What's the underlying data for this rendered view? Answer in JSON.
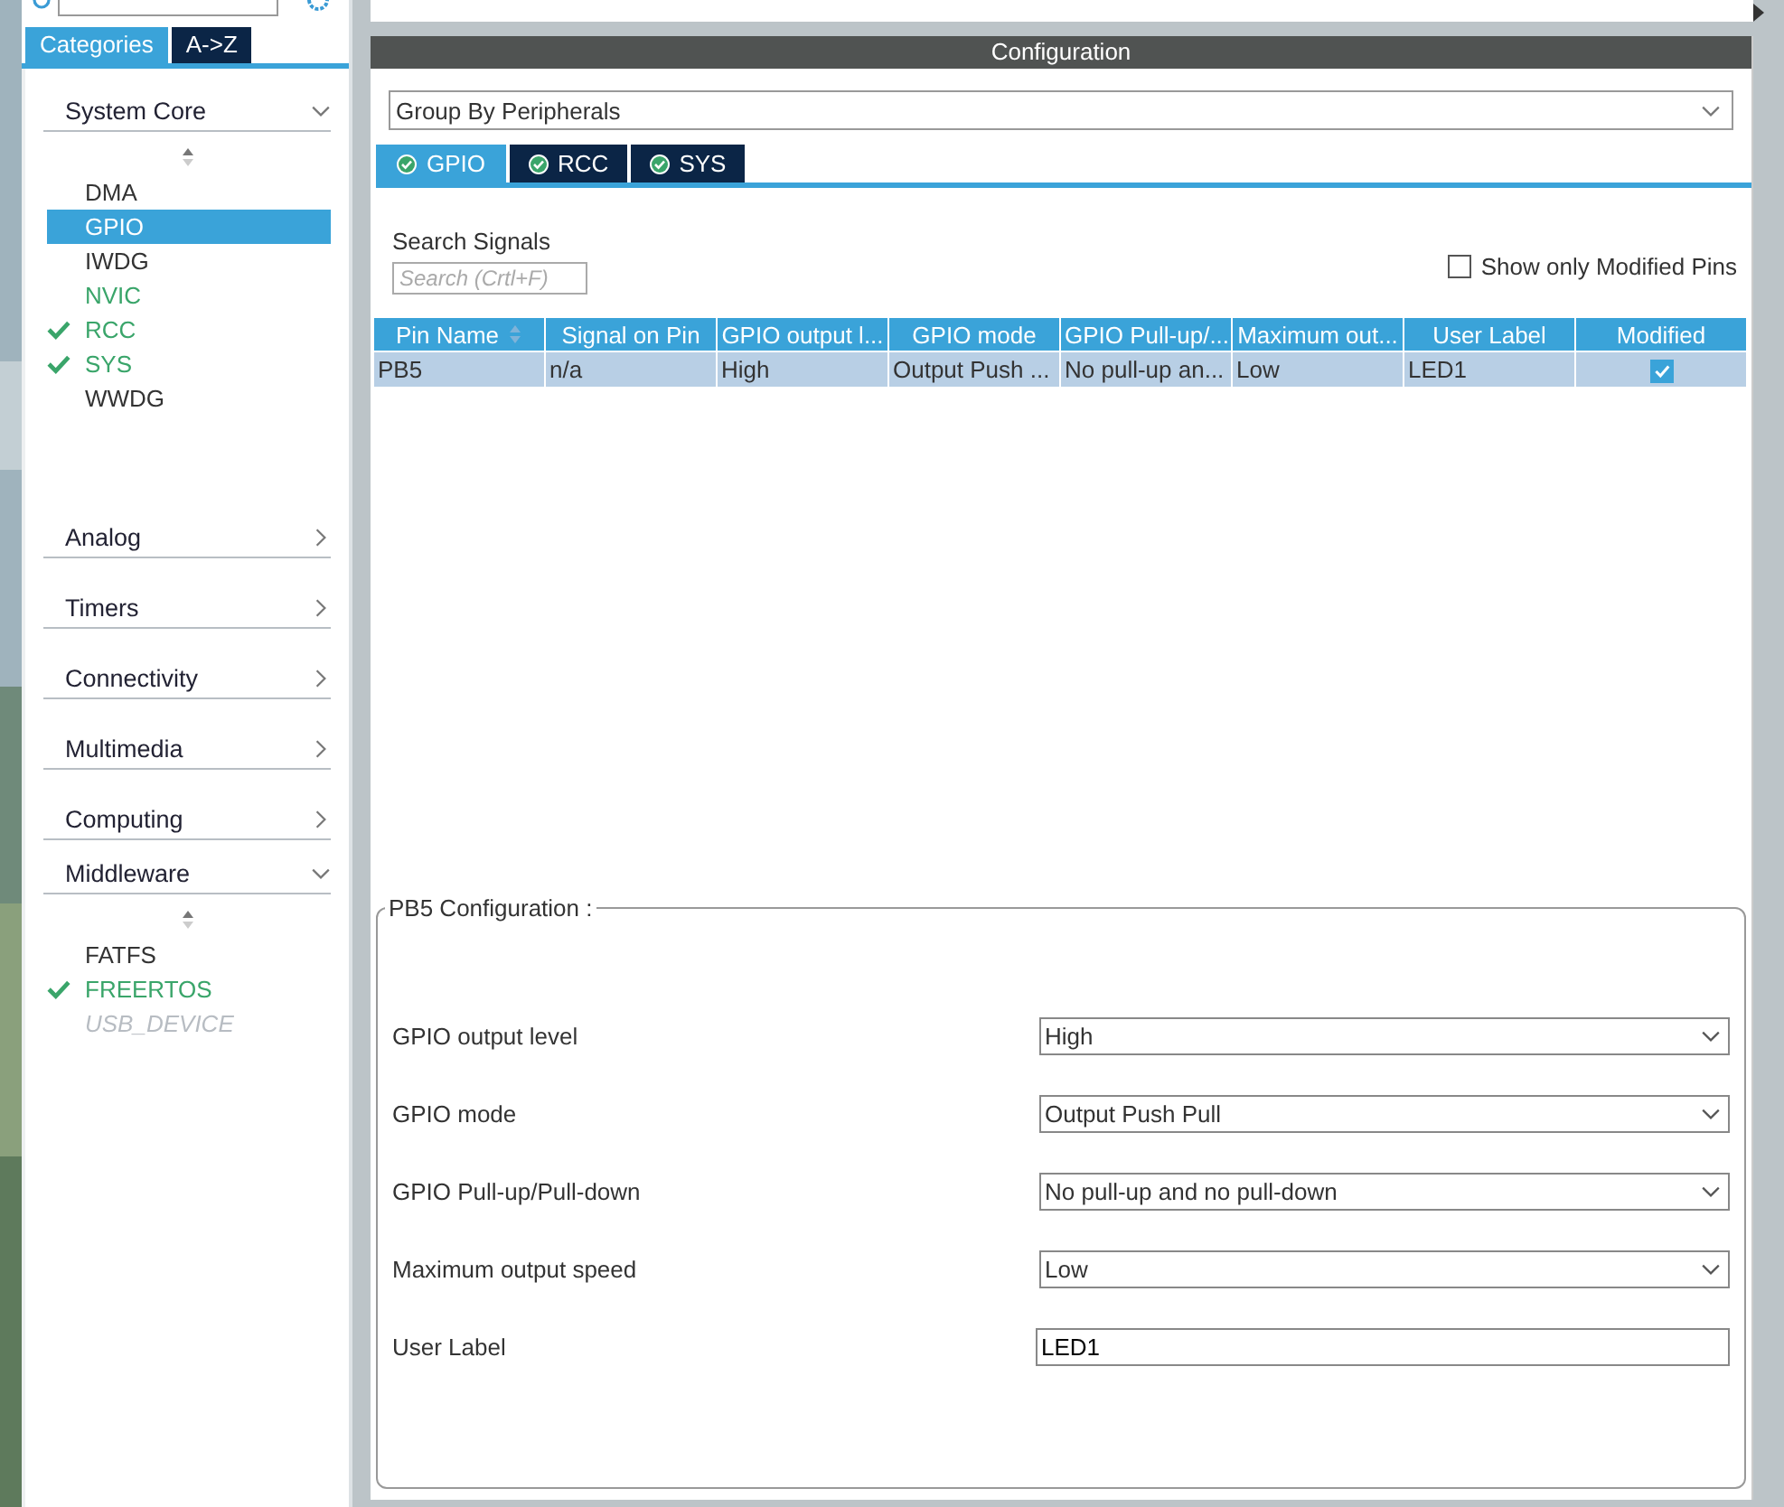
{
  "sidebar": {
    "tabs": [
      {
        "label": "Categories",
        "selected": true
      },
      {
        "label": "A->Z",
        "selected": false
      }
    ],
    "categories": [
      {
        "label": "System Core",
        "expanded": true,
        "items": [
          {
            "label": "DMA",
            "selected": false,
            "checked": false,
            "configured": false,
            "disabled": false
          },
          {
            "label": "GPIO",
            "selected": true,
            "checked": false,
            "configured": false,
            "disabled": false
          },
          {
            "label": "IWDG",
            "selected": false,
            "checked": false,
            "configured": false,
            "disabled": false
          },
          {
            "label": "NVIC",
            "selected": false,
            "checked": false,
            "configured": true,
            "disabled": false
          },
          {
            "label": "RCC",
            "selected": false,
            "checked": true,
            "configured": true,
            "disabled": false
          },
          {
            "label": "SYS",
            "selected": false,
            "checked": true,
            "configured": true,
            "disabled": false
          },
          {
            "label": "WWDG",
            "selected": false,
            "checked": false,
            "configured": false,
            "disabled": false
          }
        ]
      },
      {
        "label": "Analog",
        "expanded": false
      },
      {
        "label": "Timers",
        "expanded": false
      },
      {
        "label": "Connectivity",
        "expanded": false
      },
      {
        "label": "Multimedia",
        "expanded": false
      },
      {
        "label": "Computing",
        "expanded": false
      },
      {
        "label": "Middleware",
        "expanded": true,
        "items": [
          {
            "label": "FATFS",
            "selected": false,
            "checked": false,
            "configured": false,
            "disabled": false
          },
          {
            "label": "FREERTOS",
            "selected": false,
            "checked": true,
            "configured": true,
            "disabled": false
          },
          {
            "label": "USB_DEVICE",
            "selected": false,
            "checked": false,
            "configured": false,
            "disabled": true
          }
        ]
      }
    ]
  },
  "configuration": {
    "title": "Configuration",
    "group_by": "Group By Peripherals",
    "tabs": [
      {
        "label": "GPIO",
        "selected": true
      },
      {
        "label": "RCC",
        "selected": false
      },
      {
        "label": "SYS",
        "selected": false
      }
    ],
    "search_label": "Search Signals",
    "search": {
      "placeholder": "Search (Crtl+F)"
    },
    "show_only_modified": {
      "label": "Show only Modified Pins",
      "checked": false
    },
    "table": {
      "columns": [
        "Pin Name",
        "Signal on Pin",
        "GPIO output l...",
        "GPIO mode",
        "GPIO Pull-up/...",
        "Maximum out...",
        "User Label",
        "Modified"
      ],
      "rows": [
        {
          "cells": [
            "PB5",
            "n/a",
            "High",
            "Output Push ...",
            "No pull-up an...",
            "Low",
            "LED1"
          ],
          "modified": true,
          "selected": true
        }
      ]
    },
    "pin_config": {
      "title": "PB5 Configuration :",
      "fields": [
        {
          "label": "GPIO output level",
          "value": "High",
          "kind": "select"
        },
        {
          "label": "GPIO mode",
          "value": "Output Push Pull",
          "kind": "select"
        },
        {
          "label": "GPIO Pull-up/Pull-down",
          "value": "No pull-up and no pull-down",
          "kind": "select"
        },
        {
          "label": "Maximum output speed",
          "value": "Low",
          "kind": "select"
        },
        {
          "label": "User Label",
          "value": "LED1",
          "kind": "text"
        }
      ]
    }
  }
}
